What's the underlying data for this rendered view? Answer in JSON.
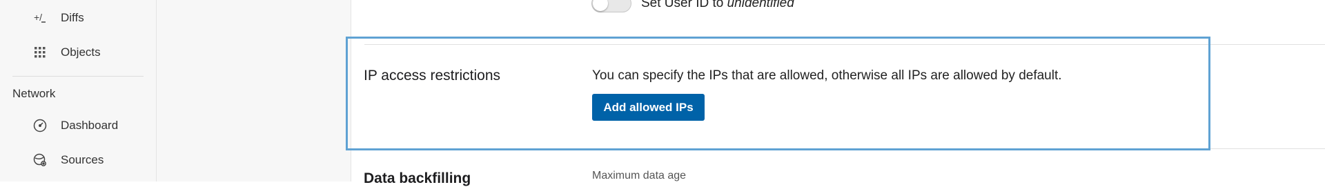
{
  "sidebar": {
    "items_top": [
      {
        "label": "Diffs",
        "icon": "diff-icon"
      },
      {
        "label": "Objects",
        "icon": "grid-icon"
      }
    ],
    "section_title": "Network",
    "items_network": [
      {
        "label": "Dashboard",
        "icon": "speedometer-icon"
      },
      {
        "label": "Sources",
        "icon": "sources-icon"
      }
    ]
  },
  "settings": {
    "toggle": {
      "label_prefix": "Set User ID to ",
      "label_em": "unidentified",
      "on": false
    },
    "ip_restrictions": {
      "title": "IP access restrictions",
      "description": "You can specify the IPs that are allowed, otherwise all IPs are allowed by default.",
      "button": "Add allowed IPs"
    },
    "next_section": {
      "title": "Data backfilling",
      "subtitle": "Maximum data age"
    }
  },
  "colors": {
    "primary": "#0062a8",
    "highlight": "#5fa2d3"
  }
}
